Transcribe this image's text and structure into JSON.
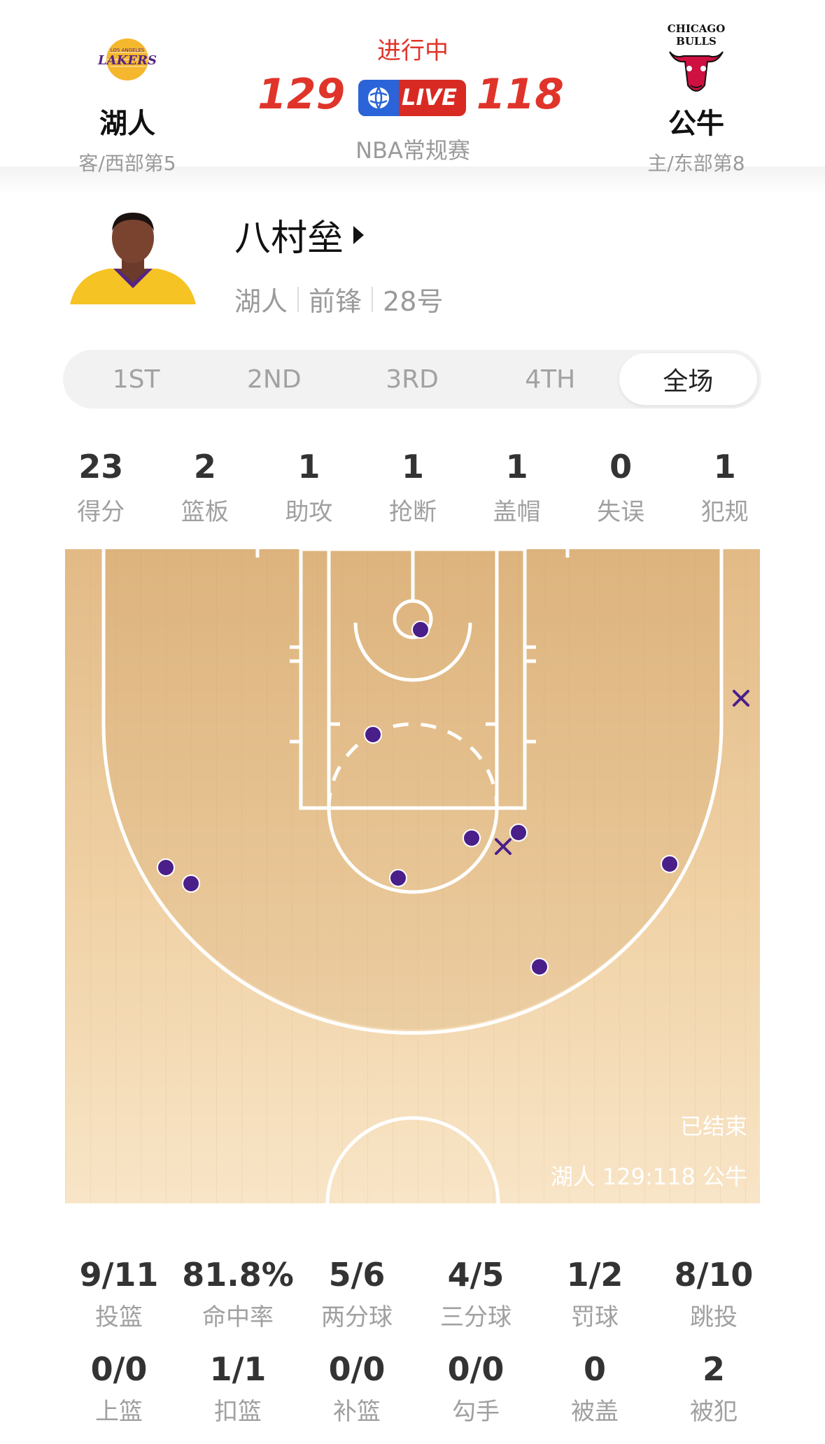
{
  "header": {
    "away": {
      "name": "湖人",
      "sub": "客/西部第5",
      "score": "129",
      "logo_text": "LAKERS",
      "logo_small": "LOS ANGELES"
    },
    "home": {
      "name": "公牛",
      "sub": "主/东部第8",
      "score": "118",
      "logo_text_top": "CHICAGO",
      "logo_text_bottom": "BULLS"
    },
    "status": "进行中",
    "live_label": "LIVE",
    "game_type": "NBA常规赛"
  },
  "player": {
    "name": "八村垒",
    "team": "湖人",
    "position": "前锋",
    "number": "28号"
  },
  "periods": {
    "tabs": [
      "1ST",
      "2ND",
      "3RD",
      "4TH",
      "全场"
    ],
    "active_index": 4
  },
  "stats": [
    {
      "value": "23",
      "label": "得分"
    },
    {
      "value": "2",
      "label": "篮板"
    },
    {
      "value": "1",
      "label": "助攻"
    },
    {
      "value": "1",
      "label": "抢断"
    },
    {
      "value": "1",
      "label": "盖帽"
    },
    {
      "value": "0",
      "label": "失误"
    },
    {
      "value": "1",
      "label": "犯规"
    }
  ],
  "court": {
    "result": "已结束",
    "score_text": "湖人 129:118 公牛",
    "made_color": "#4a1f8a",
    "miss_color": "#4a1f8a"
  },
  "shooting": [
    [
      {
        "value": "9/11",
        "label": "投篮"
      },
      {
        "value": "81.8%",
        "label": "命中率"
      },
      {
        "value": "5/6",
        "label": "两分球"
      },
      {
        "value": "4/5",
        "label": "三分球"
      },
      {
        "value": "1/2",
        "label": "罚球"
      },
      {
        "value": "8/10",
        "label": "跳投"
      }
    ],
    [
      {
        "value": "0/0",
        "label": "上篮"
      },
      {
        "value": "1/1",
        "label": "扣篮"
      },
      {
        "value": "0/0",
        "label": "补篮"
      },
      {
        "value": "0/0",
        "label": "勾手"
      },
      {
        "value": "0",
        "label": "被盖"
      },
      {
        "value": "2",
        "label": "被犯"
      }
    ]
  ]
}
